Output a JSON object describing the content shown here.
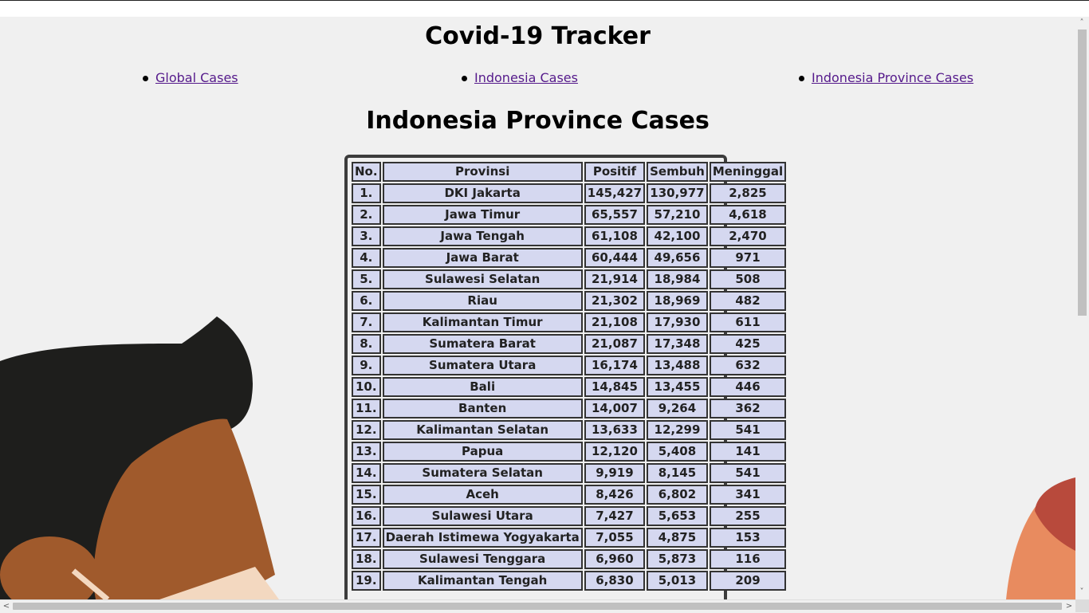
{
  "title": "Covid-19 Tracker",
  "nav": [
    {
      "label": "Global Cases"
    },
    {
      "label": "Indonesia Cases"
    },
    {
      "label": "Indonesia Province Cases"
    }
  ],
  "section_title": "Indonesia Province Cases",
  "table": {
    "headers": [
      "No.",
      "Provinsi",
      "Positif",
      "Sembuh",
      "Meninggal"
    ],
    "rows": [
      [
        "1.",
        "DKI Jakarta",
        "145,427",
        "130,977",
        "2,825"
      ],
      [
        "2.",
        "Jawa Timur",
        "65,557",
        "57,210",
        "4,618"
      ],
      [
        "3.",
        "Jawa Tengah",
        "61,108",
        "42,100",
        "2,470"
      ],
      [
        "4.",
        "Jawa Barat",
        "60,444",
        "49,656",
        "971"
      ],
      [
        "5.",
        "Sulawesi Selatan",
        "21,914",
        "18,984",
        "508"
      ],
      [
        "6.",
        "Riau",
        "21,302",
        "18,969",
        "482"
      ],
      [
        "7.",
        "Kalimantan Timur",
        "21,108",
        "17,930",
        "611"
      ],
      [
        "8.",
        "Sumatera Barat",
        "21,087",
        "17,348",
        "425"
      ],
      [
        "9.",
        "Sumatera Utara",
        "16,174",
        "13,488",
        "632"
      ],
      [
        "10.",
        "Bali",
        "14,845",
        "13,455",
        "446"
      ],
      [
        "11.",
        "Banten",
        "14,007",
        "9,264",
        "362"
      ],
      [
        "12.",
        "Kalimantan Selatan",
        "13,633",
        "12,299",
        "541"
      ],
      [
        "13.",
        "Papua",
        "12,120",
        "5,408",
        "141"
      ],
      [
        "14.",
        "Sumatera Selatan",
        "9,919",
        "8,145",
        "541"
      ],
      [
        "15.",
        "Aceh",
        "8,426",
        "6,802",
        "341"
      ],
      [
        "16.",
        "Sulawesi Utara",
        "7,427",
        "5,653",
        "255"
      ],
      [
        "17.",
        "Daerah Istimewa Yogyakarta",
        "7,055",
        "4,875",
        "153"
      ],
      [
        "18.",
        "Sulawesi Tenggara",
        "6,960",
        "5,873",
        "116"
      ],
      [
        "19.",
        "Kalimantan Tengah",
        "6,830",
        "5,013",
        "209"
      ]
    ]
  },
  "scrollbar": {
    "left_arrow": "<",
    "right_arrow": ">",
    "down_arrow": "˅"
  }
}
